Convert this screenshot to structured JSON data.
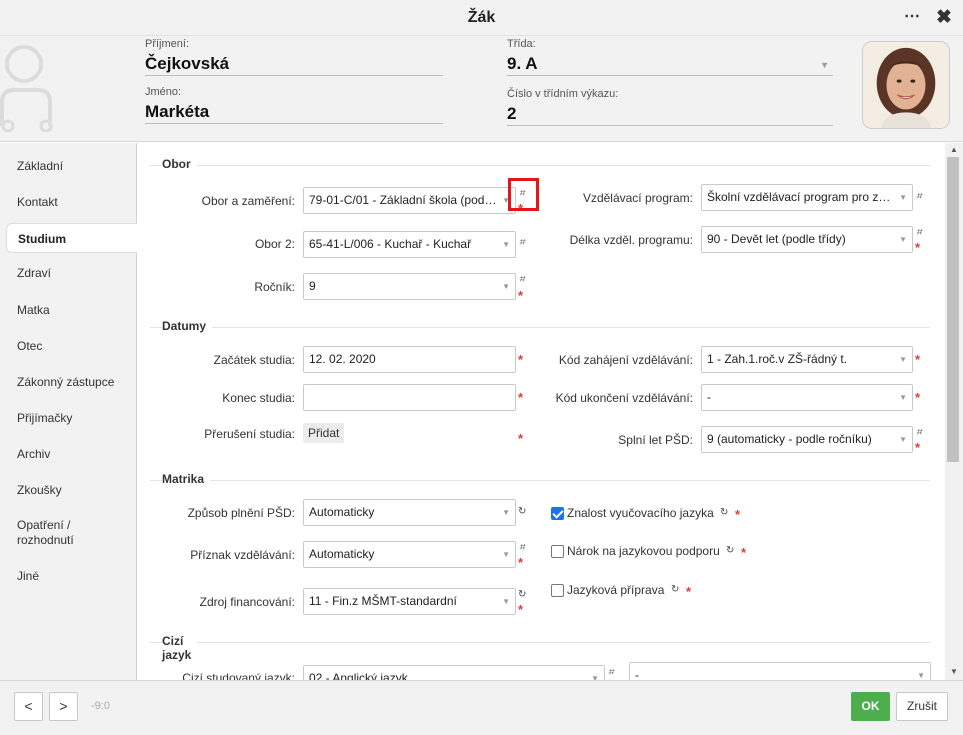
{
  "window": {
    "title": "Žák",
    "more_glyph": "⋯",
    "close_glyph": "✖"
  },
  "header": {
    "surname_label": "Příjmení:",
    "surname": "Čejkovská",
    "name_label": "Jméno:",
    "name": "Markéta",
    "class_label": "Třída:",
    "class": "9. A",
    "number_label": "Číslo v třídním výkazu:",
    "number": "2"
  },
  "sidebar": {
    "items": [
      {
        "label": "Základní"
      },
      {
        "label": "Kontakt"
      },
      {
        "label": "Studium",
        "active": true
      },
      {
        "label": "Zdraví"
      },
      {
        "label": "Matka"
      },
      {
        "label": "Otec"
      },
      {
        "label": "Zákonný zástupce"
      },
      {
        "label": "Přijímačky"
      },
      {
        "label": "Archiv"
      },
      {
        "label": "Zkoušky"
      },
      {
        "label": "Opatření /\nrozhodnutí"
      },
      {
        "label": "Jiné"
      }
    ]
  },
  "symbols": {
    "hash": "⌗",
    "required": "*",
    "refresh": "↻",
    "arrow": "▼",
    "arrow_up": "▲"
  },
  "sections": {
    "obor": {
      "title": "Obor",
      "obor_label": "Obor a zaměření:",
      "obor_value": "79-01-C/01 - Základní škola (podle...",
      "obor2_label": "Obor 2:",
      "obor2_value": "65-41-L/006 - Kuchař - Kuchař",
      "rocnik_label": "Ročník:",
      "rocnik_value": "9",
      "program_label": "Vzdělávací program:",
      "program_value": "Školní vzdělávací program pro zák...",
      "delka_label": "Délka vzděl. programu:",
      "delka_value": "90 - Devět let (podle třídy)"
    },
    "datumy": {
      "title": "Datumy",
      "zacatek_label": "Začátek studia:",
      "zacatek_value": "12. 02. 2020",
      "konec_label": "Konec studia:",
      "konec_value": "",
      "preruseni_label": "Přerušení studia:",
      "pridat_button": "Přidat",
      "kod_zah_label": "Kód zahájení vzdělávání:",
      "kod_zah_value": "1 - Zah.1.roč.v ZŠ-řádný t.",
      "kod_uk_label": "Kód ukončení vzdělávání:",
      "kod_uk_value": "-",
      "splni_label": "Splní let PŠD:",
      "splni_value": "9 (automaticky - podle ročníku)"
    },
    "matrika": {
      "title": "Matrika",
      "zpusob_label": "Způsob plnění PŠD:",
      "zpusob_value": "Automaticky",
      "priznak_label": "Příznak vzdělávání:",
      "priznak_value": "Automaticky",
      "zdroj_label": "Zdroj financování:",
      "zdroj_value": "11 - Fin.z MŠMT-standardní",
      "znalost_label": "Znalost vyučovacího jazyka",
      "znalost_checked": true,
      "narok_label": "Nárok na jazykovou podporu",
      "narok_checked": false,
      "priprava_label": "Jazyková příprava",
      "priprava_checked": false
    },
    "cizi": {
      "title": "Cizí jazyk",
      "jazyk_label": "Cizí studovaný jazyk:",
      "jazyk_value": "02 - Anglický jazyk",
      "jazyk2_value": "-"
    }
  },
  "footer": {
    "prev": "<",
    "next": ">",
    "counter": "-9:0",
    "ok": "OK",
    "cancel": "Zrušit"
  },
  "colors": {
    "ok_green": "#4cae4c",
    "required_red": "#e23b3b",
    "checkbox_blue": "#1a73e8",
    "highlight": "#e4161a"
  }
}
